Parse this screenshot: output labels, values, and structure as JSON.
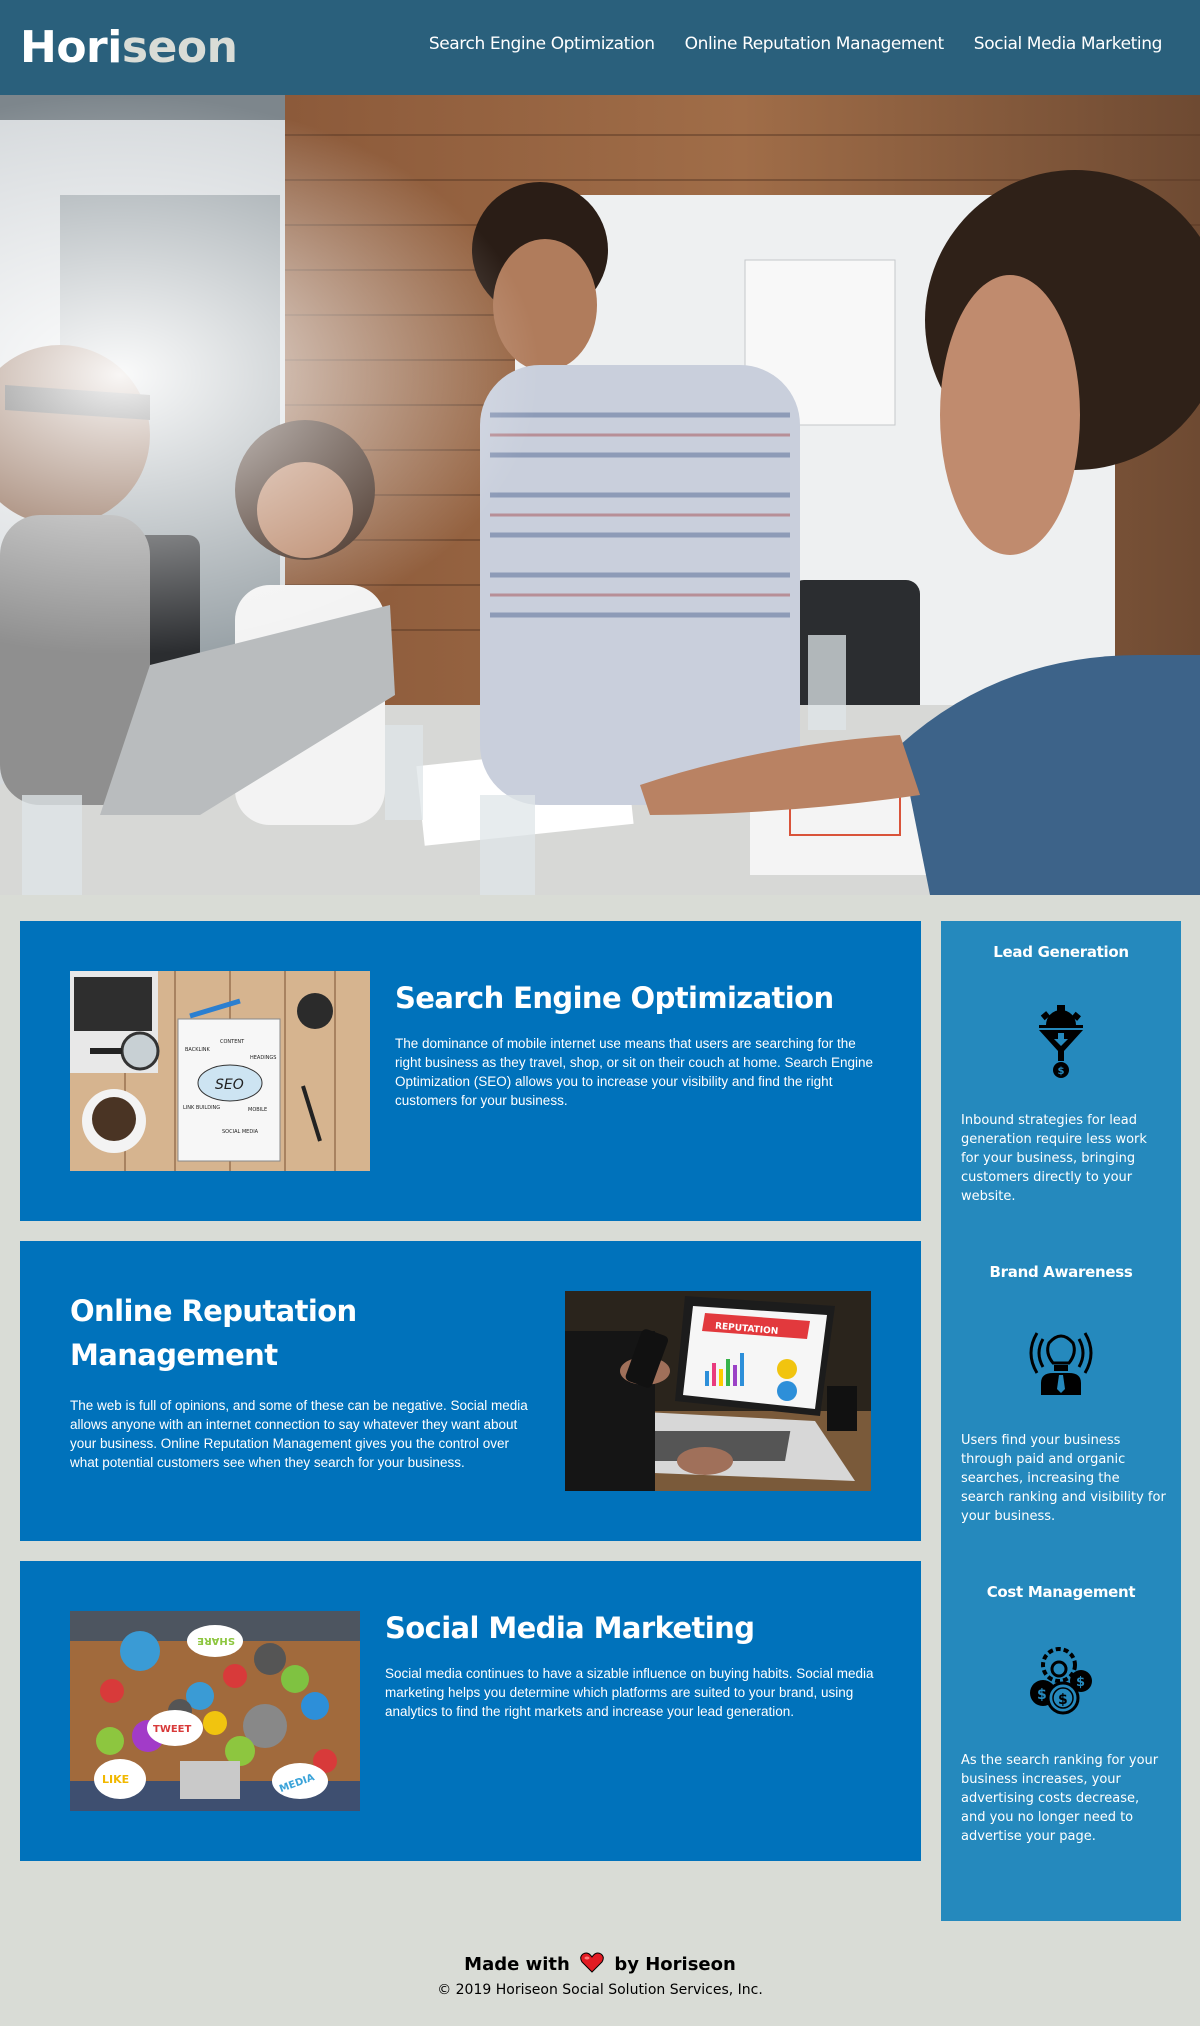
{
  "header": {
    "logo_primary": "Hori",
    "logo_accent": "seon",
    "nav": [
      {
        "label": "Search Engine Optimization"
      },
      {
        "label": "Online Reputation Management"
      },
      {
        "label": "Social Media Marketing"
      }
    ]
  },
  "hero": {
    "icon": "team-meeting-photo"
  },
  "content": [
    {
      "title": "Search Engine Optimization",
      "text": "The dominance of mobile internet use means that users are searching for the right business as they travel, shop, or sit on their couch at home. Search Engine Optimization (SEO) allows you to increase your visibility and find the right customers for your business.",
      "image": "seo-notebook-photo"
    },
    {
      "title": "Online Reputation Management",
      "text": "The web is full of opinions, and some of these can be negative. Social media allows anyone with an internet connection to say whatever they want about your business. Online Reputation Management gives you the control over what potential customers see when they search for your business.",
      "image": "reputation-laptop-photo",
      "image_label": "REPUTATION"
    },
    {
      "title": "Social Media Marketing",
      "text": "Social media continues to have a sizable influence on buying habits. Social media marketing helps you determine which platforms are suited to your brand, using analytics to find the right markets and increase your lead generation.",
      "image": "social-media-table-photo",
      "image_labels": [
        "SHARE",
        "TWEET",
        "LIKE",
        "MEDIA"
      ]
    }
  ],
  "benefits": [
    {
      "title": "Lead Generation",
      "icon": "lead-funnel-icon",
      "text": "Inbound strategies for lead generation require less work for your business, bringing customers directly to your website."
    },
    {
      "title": "Brand Awareness",
      "icon": "lightbulb-person-icon",
      "text": "Users find your business through paid and organic searches, increasing the search ranking and visibility for your business."
    },
    {
      "title": "Cost Management",
      "icon": "coins-gear-icon",
      "text": "As the search ranking for your business increases, your advertising costs decrease, and you no longer need to advertise your page."
    }
  ],
  "footer": {
    "made_prefix": "Made with",
    "made_suffix": "by Horiseon",
    "copyright": "© 2019 Horiseon Social Solution Services, Inc."
  },
  "colors": {
    "header_bg": "#2a607c",
    "page_bg": "#d9dcd6",
    "card_bg": "#0072bb",
    "sidebar_bg": "#2589bd",
    "heart": "#e21b23"
  }
}
